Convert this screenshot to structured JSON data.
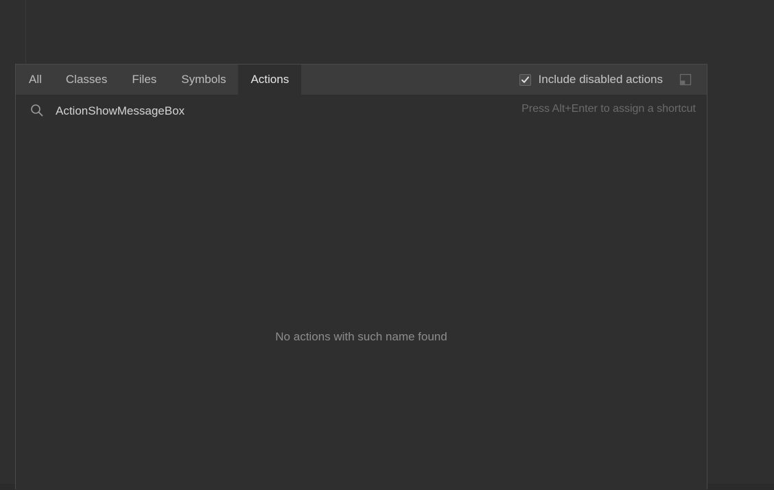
{
  "tabs": [
    {
      "label": "All",
      "active": false
    },
    {
      "label": "Classes",
      "active": false
    },
    {
      "label": "Files",
      "active": false
    },
    {
      "label": "Symbols",
      "active": false
    },
    {
      "label": "Actions",
      "active": true
    }
  ],
  "options": {
    "include_disabled_label": "Include disabled actions",
    "include_disabled_checked": true,
    "preview_icon": "preview-pane-icon"
  },
  "search": {
    "value": "ActionShowMessageBox",
    "icon": "search-icon",
    "hint": "Press Alt+Enter to assign a shortcut"
  },
  "results": {
    "empty_message": "No actions with such name found"
  },
  "colors": {
    "background": "#2f2f2f",
    "tabbar": "#3c3c3c",
    "active_tab": "#2f2f2f",
    "border": "#4a4a4a",
    "hint": "#6b6b6b"
  }
}
